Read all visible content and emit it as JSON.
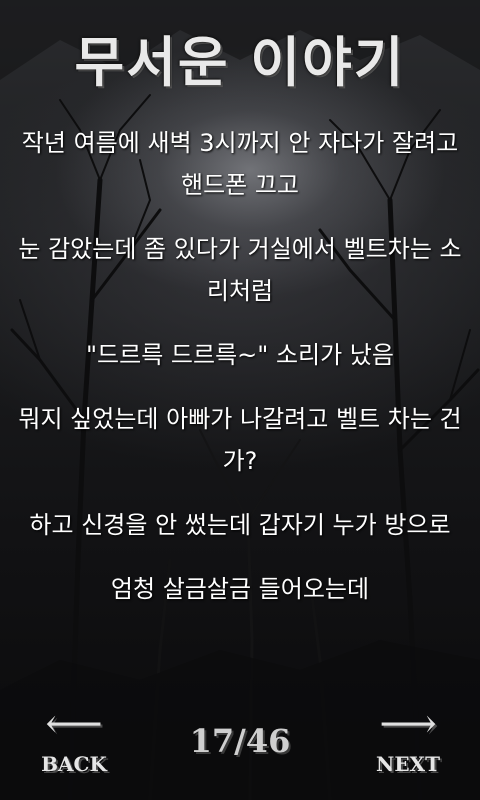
{
  "app": {
    "title": "무서운 이야기"
  },
  "story": {
    "paragraphs": [
      "작년 여름에 새벽 3시까지 안 자다가 잘려고 핸드폰 끄고",
      "눈 감았는데 좀 있다가 거실에서 벨트차는 소리처럼",
      "\"드르륵 드르륵~\" 소리가 났음",
      "뭐지 싶었는데 아빠가 나갈려고 벨트 차는 건가?",
      "하고 신경을 안 썼는데 갑자기 누가 방으로",
      "엄청 살금살금 들어오는데"
    ]
  },
  "nav": {
    "back_label": "BACK",
    "next_label": "NEXT",
    "back_arrow": "⟵",
    "next_arrow": "⟶",
    "page_indicator": "17/46"
  },
  "pagination": {
    "current": 17,
    "total": 46
  },
  "icons": {
    "back": "arrow-left-icon",
    "next": "arrow-right-icon"
  },
  "colors": {
    "text": "#ffffff",
    "title": "#e9e9e9",
    "background": "#1b1c1e"
  }
}
